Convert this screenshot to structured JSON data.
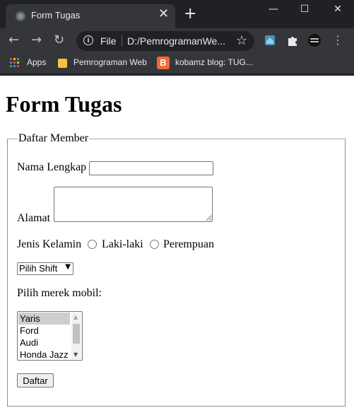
{
  "browser": {
    "tab_title": "Form Tugas",
    "tab_close": "✕",
    "new_tab": "+",
    "window_minimize": "—",
    "window_maximize": "☐",
    "window_close": "✕",
    "omnibox_scheme": "File",
    "omnibox_url": "D:/PemrogramanWe...",
    "icons": [
      "back-icon",
      "forward-icon",
      "reload-icon",
      "info-icon",
      "star-icon",
      "home-extension-icon",
      "puzzle-icon",
      "profile-icon",
      "menu-icon"
    ]
  },
  "bookmarks": {
    "apps": "Apps",
    "folder": "Pemrograman Web",
    "blog": "kobamz blog: TUG..."
  },
  "page": {
    "heading": "Form Tugas",
    "legend": "Daftar Member",
    "name_label": "Nama Lengkap",
    "address_label": "Alamat",
    "gender_label": "Jenis Kelamin",
    "gender_male": "Laki-laki",
    "gender_female": "Perempuan",
    "shift_select": "Pilih Shift",
    "car_label": "Pilih merek mobil:",
    "cars": [
      "Yaris",
      "Ford",
      "Audi",
      "Honda Jazz"
    ],
    "submit": "Daftar"
  },
  "colors": {
    "chrome_dark": "#202124",
    "chrome_toolbar": "#35363a",
    "listbox_selected": "#cecece"
  }
}
